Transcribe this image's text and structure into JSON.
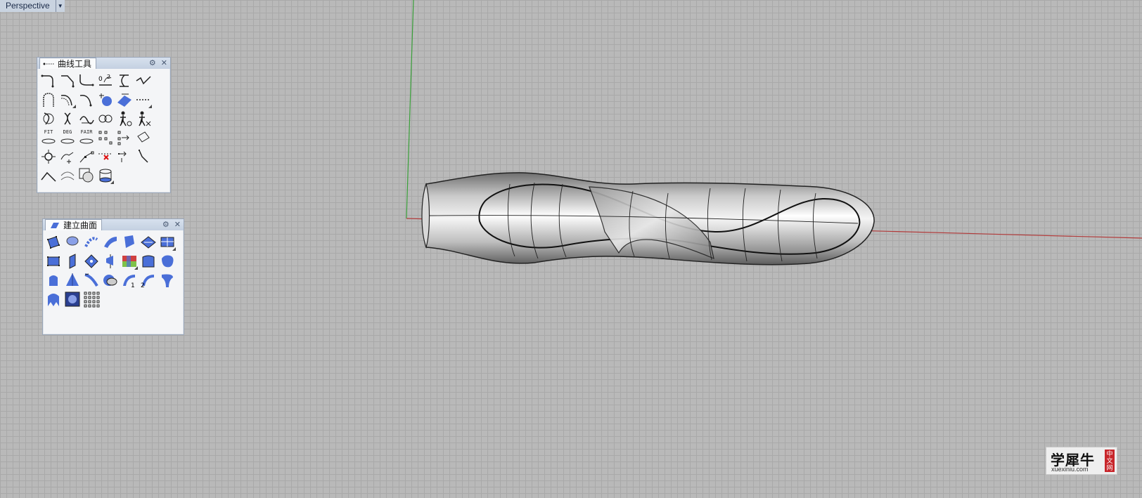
{
  "viewport": {
    "name": "Perspective",
    "dropdown_glyph": "▼"
  },
  "panels": {
    "curve_tools": {
      "title": "曲线工具",
      "icons": [
        "curve-fillet-icon",
        "curve-chamfer-icon",
        "blend-curve-icon",
        "match-curve-icon",
        "adjustable-blend-icon",
        "curve-connect-icon",
        "arc-blend-icon",
        "offset-curve-icon",
        "extend-curve-icon",
        "curve-on-surface-icon",
        "offset-on-surface-icon",
        "dashed-curve-icon",
        "rebuild-curve-icon",
        "refit-curve-icon",
        "fair-curve-icon",
        "simplify-curve-icon",
        "change-degree-icon",
        "adjust-seam-icon",
        "fit-curve-icon",
        "degree-curve-icon",
        "fair-icon",
        "insert-knot-icon",
        "remove-knot-icon",
        "crv-seam-icon",
        "point-on-curve-icon",
        "add-kink-icon",
        "insert-point-icon",
        "remove-point-icon",
        "move-point-icon",
        "corner-icon",
        "convert-polyline-icon",
        "arc-convert-icon",
        "sphere-convert-icon",
        "cylinder-convert-icon"
      ],
      "text_icons": {
        "fit": "FIT",
        "deg": "DEG",
        "fair": "FAIR"
      },
      "settings_glyph": "⚙",
      "close_glyph": "✕"
    },
    "surface_create": {
      "title": "建立曲面",
      "icons": [
        "surface-from-points-icon",
        "patch-icon",
        "sweep-icon",
        "loft-icon",
        "edge-surface-icon",
        "planar-surface-icon",
        "grid-surface-icon",
        "corner-surface-icon",
        "extrude-surface-icon",
        "revolve-surface-icon",
        "network-surface-icon",
        "drape-icon",
        "heightfield-icon",
        "blob-icon",
        "extrude-cap-icon",
        "pyramid-icon",
        "sweep-rail-icon",
        "patch-blend-icon",
        "sweep-one-icon",
        "sweep-two-icon",
        "flow-surface-icon",
        "drape-mesh-icon",
        "heightfield-image-icon",
        "point-grid-icon"
      ],
      "settings_glyph": "⚙",
      "close_glyph": "✕"
    }
  },
  "watermark": {
    "main": "学犀牛",
    "sub": "xuexiniu.com",
    "seal": "中文网"
  },
  "colors": {
    "accent_blue": "#3a5fcd",
    "axis_x": "#b23a3a",
    "axis_y": "#3aa03a"
  }
}
